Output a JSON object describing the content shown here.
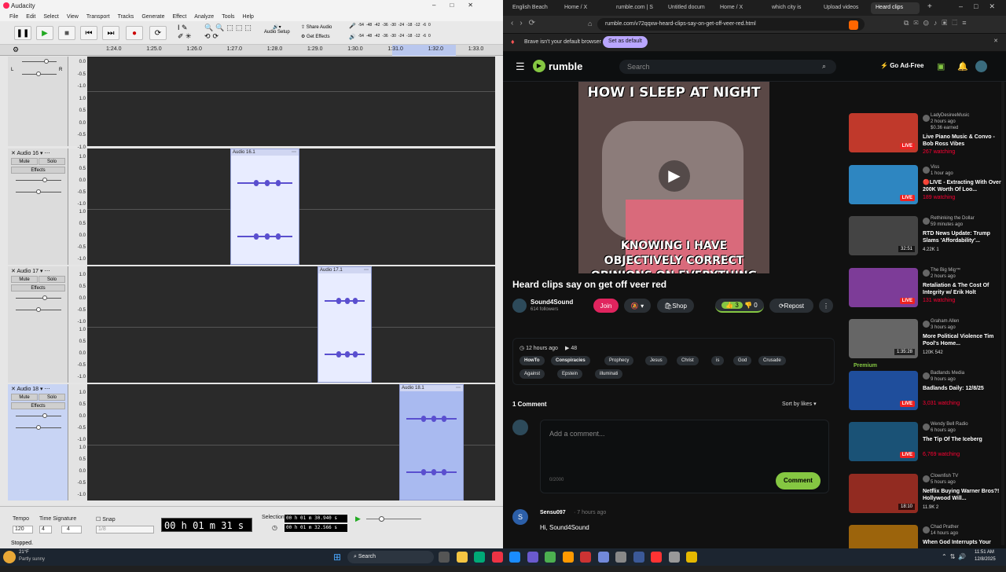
{
  "audacity": {
    "window_title": "Audacity",
    "menus": [
      "File",
      "Edit",
      "Select",
      "View",
      "Transport",
      "Tracks",
      "Generate",
      "Effect",
      "Analyze",
      "Tools",
      "Help"
    ],
    "toolbar": {
      "audio_setup": "Audio Setup",
      "share_audio": "Share Audio",
      "get_effects": "Get Effects"
    },
    "meter_ticks": [
      "-54",
      "-48",
      "-42",
      "-36",
      "-30",
      "-24",
      "-18",
      "-12",
      "-6",
      "0"
    ],
    "ruler_ticks": [
      "1:24.0",
      "1:25.0",
      "1:26.0",
      "1:27.0",
      "1:28.0",
      "1:29.0",
      "1:30.0",
      "1:31.0",
      "1:32.0",
      "1:33.0"
    ],
    "scale_labels": [
      "1.0",
      "0.5",
      "0.0",
      "-0.5",
      "-1.0"
    ],
    "top_scale": [
      "0.0",
      "-0.5",
      "-1.0",
      "1.0",
      "0.5",
      "0.0",
      "-0.5",
      "-1.0"
    ],
    "tracks": [
      {
        "name": "Audio 16",
        "clip": "Audio 16.1",
        "mute": "Mute",
        "solo": "Solo",
        "effects": "Effects"
      },
      {
        "name": "Audio 17",
        "clip": "Audio 17.1",
        "mute": "Mute",
        "solo": "Solo",
        "effects": "Effects"
      },
      {
        "name": "Audio 18",
        "clip": "Audio 18.1",
        "mute": "Mute",
        "solo": "Solo",
        "effects": "Effects"
      }
    ],
    "selection_bar": {
      "tempo_label": "Tempo",
      "tempo": "120",
      "time_sig_label": "Time Signature",
      "time_sig_num": "4",
      "time_sig_den": "4",
      "snap_label": "Snap",
      "snap_value": "1/8",
      "time": "00 h 01 m 31 s",
      "selection_label": "Selection",
      "sel_start": "00 h 01 m 30.940 s",
      "sel_end": "00 h 01 m 32.566 s"
    },
    "status": "Stopped."
  },
  "browser": {
    "tabs": [
      "English Beach",
      "Home / X",
      "rumble.com | S",
      "Untitled docum",
      "Home / X",
      "which city is",
      "Upload videos",
      "Heard clips"
    ],
    "url": "rumble.com/v72qqxw-heard-clips-say-on-get-off-veer-red.html",
    "infobar": {
      "text": "Brave isn't your default browser",
      "button": "Set as default"
    },
    "logo": "rumble",
    "search_placeholder": "Search",
    "go_ad_free": "Go Ad-Free",
    "video": {
      "top_text": "HOW I SLEEP AT NIGHT",
      "bottom_text": "KNOWING I HAVE OBJECTIVELY CORRECT OPINIONS ON EVERYTHING"
    },
    "title": "Heard clips say on get off veer red",
    "channel": {
      "name": "Sound4Sound",
      "followers": "614 followers",
      "join": "Join",
      "shop": "Shop",
      "likes": "3",
      "dislikes": "0",
      "repost": "Repost"
    },
    "meta": {
      "posted": "12 hours ago",
      "views": "48"
    },
    "tags": [
      "HowTo",
      "Conspiracies",
      "Prophecy",
      "Jesus",
      "Christ",
      "is",
      "God",
      "Crusade",
      "Against",
      "Epstein",
      "illuminati"
    ],
    "comments": {
      "count": "1 Comment",
      "sort": "Sort by likes",
      "placeholder": "Add a comment...",
      "counter": "0/2000",
      "button": "Comment",
      "first": {
        "user": "Sensu097",
        "time": "7 hours ago",
        "text": "Hi, Sound4Sound",
        "avatar": "S"
      }
    },
    "sidebar": [
      {
        "channel": "LadyDesireeMusic",
        "time": "2 hours ago",
        "extra": "$0.36 earned",
        "title": "Live Piano Music & Convo - Bob Ross Vibes",
        "watching": "267 watching",
        "badge": "LIVE",
        "color": "#c0392b"
      },
      {
        "channel": "Viss",
        "time": "1 hour ago",
        "title": "🔴LIVE - Extracting With Over 200K Worth Of Loo...",
        "watching": "189 watching",
        "badge": "LIVE",
        "color": "#2e86c1"
      },
      {
        "channel": "Rethinking the Dollar",
        "time": "59 minutes ago",
        "title": "RTD News Update: Trump Slams 'Affordability'...",
        "stats": "4.22K   1",
        "badge": "32:51",
        "color": "#444"
      },
      {
        "channel": "The Big Mig™",
        "time": "2 hours ago",
        "title": "Retaliation & The Cost Of Integrity w/ Erik Holt",
        "watching": "131 watching",
        "badge": "LIVE",
        "color": "#7d3c98"
      },
      {
        "channel": "Graham Allen",
        "time": "3 hours ago",
        "title": "More Political Violence Tim Pool's Home...",
        "stats": "120K   542",
        "badge": "1:35:28",
        "premium": "Premium",
        "color": "#666"
      },
      {
        "channel": "Badlands Media",
        "time": "9 hours ago",
        "title": "Badlands Daily: 12/8/25",
        "watching": "3,031 watching",
        "badge": "LIVE",
        "color": "#1f4e9c"
      },
      {
        "channel": "Wendy Bell Radio",
        "time": "6 hours ago",
        "title": "The Tip Of The Iceberg",
        "watching": "6,769 watching",
        "badge": "LIVE",
        "color": "#1a5276"
      },
      {
        "channel": "Clownfish TV",
        "time": "5 hours ago",
        "title": "Netflix Buying Warner Bros?! Hollywood Will...",
        "stats": "11.9K   2",
        "badge": "18:10",
        "color": "#922b21"
      },
      {
        "channel": "Chad Prather",
        "time": "14 hours ago",
        "title": "When God Interrupts Your",
        "color": "#9c640c"
      }
    ]
  },
  "taskbar": {
    "weather_temp": "21°F",
    "weather_desc": "Partly sunny",
    "search": "Search",
    "time": "11:51 AM",
    "date": "12/8/2025"
  }
}
